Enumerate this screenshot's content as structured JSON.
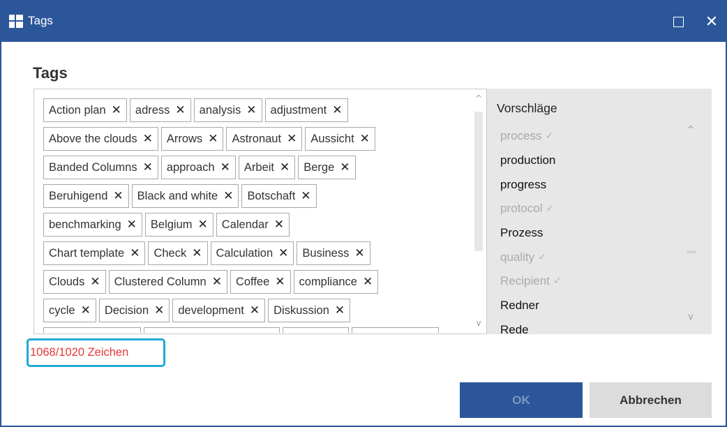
{
  "window": {
    "title": "Tags",
    "maximize_icon": "maximize-icon",
    "close_icon": "close-icon",
    "close_glyph": "✕"
  },
  "heading": "Tags",
  "tags": {
    "rows": [
      [
        "Action plan",
        "adress",
        "analysis",
        "adjustment"
      ],
      [
        "Above the clouds",
        "Arrows",
        "Astronaut",
        "Aussicht"
      ],
      [
        "Banded Columns",
        "approach",
        "Arbeit",
        "Berge"
      ],
      [
        "Beruhigend",
        "Black and white",
        "Botschaft"
      ],
      [
        "benchmarking",
        "Belgium",
        "Calendar"
      ],
      [
        "Chart template",
        "Check",
        "Calculation",
        "Business"
      ],
      [
        "Clouds",
        "Clustered Column",
        "Coffee",
        "compliance"
      ],
      [
        "cycle",
        "Decision",
        "development",
        "Diskussion"
      ],
      [
        "",
        "",
        "",
        ""
      ]
    ],
    "remove_glyph": "✕",
    "scroll_up": "^",
    "scroll_down": "v"
  },
  "suggestions": {
    "title": "Vorschläge",
    "items": [
      {
        "label": "process",
        "used": true
      },
      {
        "label": "production",
        "used": false
      },
      {
        "label": "progress",
        "used": false
      },
      {
        "label": "protocol",
        "used": true
      },
      {
        "label": "Prozess",
        "used": false
      },
      {
        "label": "quality",
        "used": true
      },
      {
        "label": "Recipient",
        "used": true
      },
      {
        "label": "Redner",
        "used": false
      },
      {
        "label": "Rede",
        "used": false
      }
    ],
    "check_glyph": "✓",
    "scroll_up": "^",
    "scroll_down": "v"
  },
  "char_count": "1068/1020 Zeichen",
  "buttons": {
    "ok": "OK",
    "cancel": "Abbrechen"
  },
  "colors": {
    "titlebar": "#2b579a",
    "accent": "#2b579a",
    "warning_text": "#e53935",
    "highlight_border": "#1eaad6"
  }
}
